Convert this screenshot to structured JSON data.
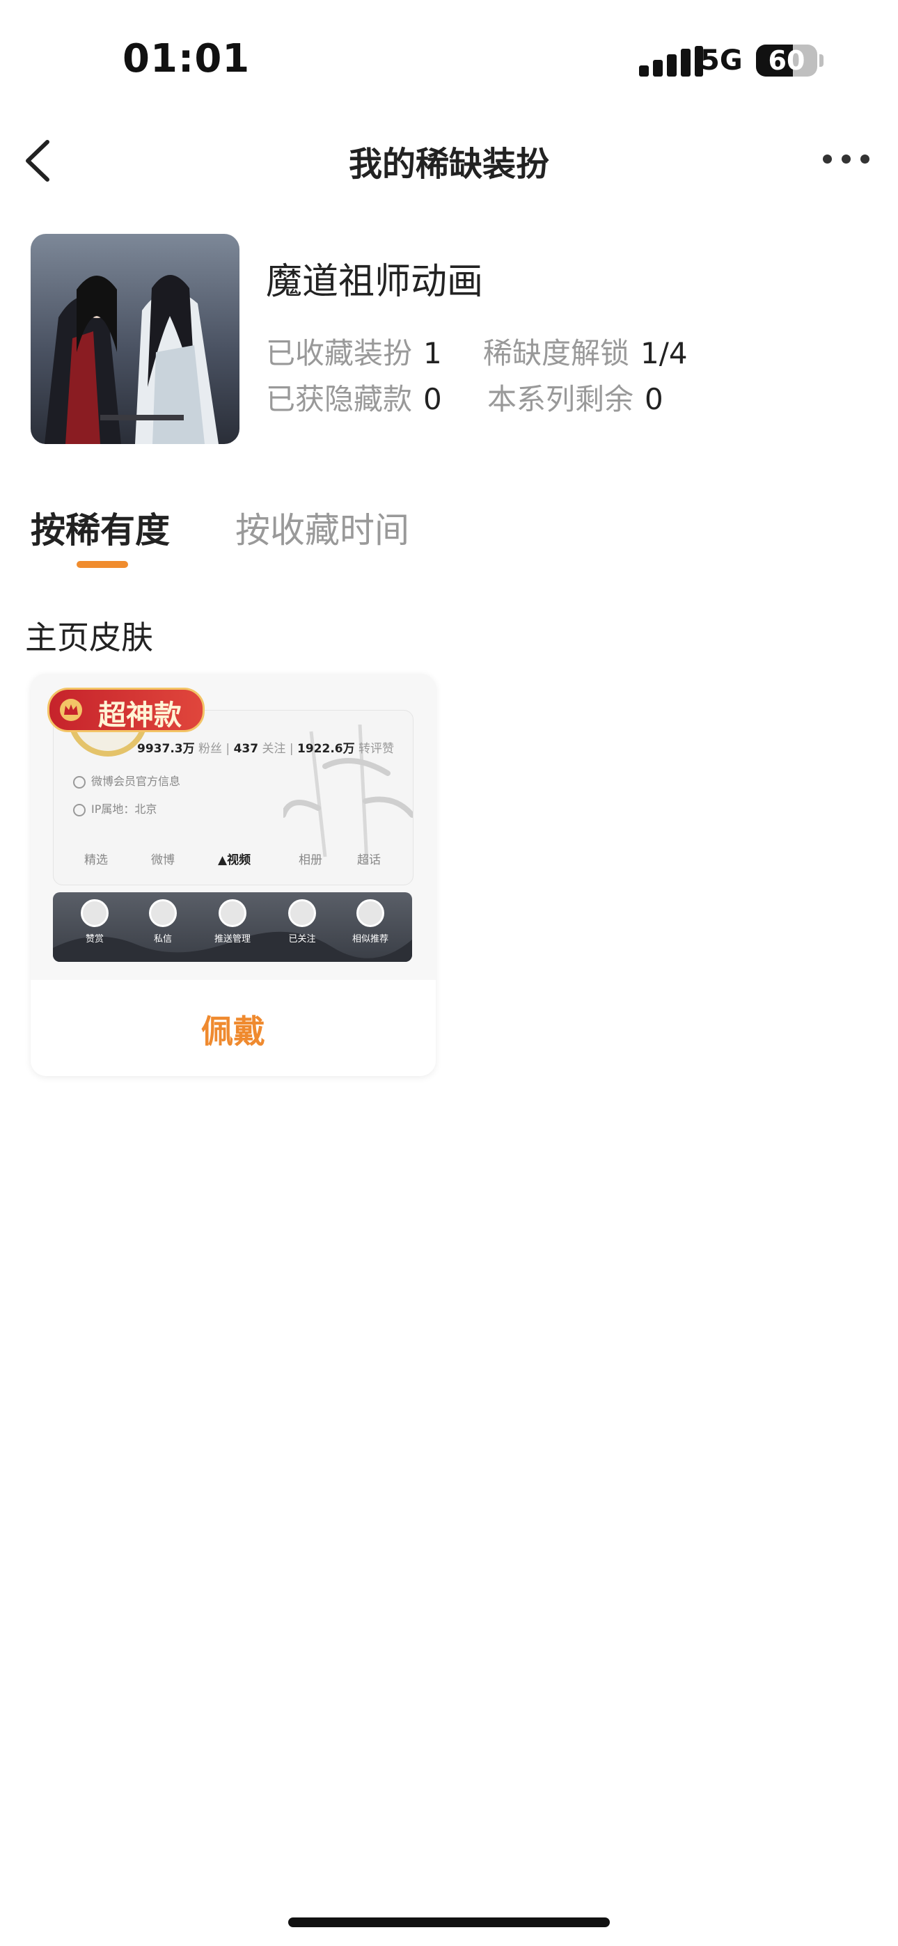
{
  "status_bar": {
    "time": "01:01",
    "network": "5G",
    "battery": "60"
  },
  "nav": {
    "title": "我的稀缺装扮"
  },
  "series": {
    "name": "魔道祖师动画",
    "stats": [
      {
        "label": "已收藏装扮",
        "value": "1"
      },
      {
        "label": "稀缺度解锁",
        "value": "1/4"
      },
      {
        "label": "已获隐藏款",
        "value": "0"
      },
      {
        "label": "本系列剩余",
        "value": "0"
      }
    ]
  },
  "tabs": [
    {
      "label": "按稀有度",
      "active": true
    },
    {
      "label": "按收藏时间",
      "active": false
    }
  ],
  "section_title": "主页皮肤",
  "skin_card": {
    "badge": "超神款",
    "wear_button": "佩戴",
    "preview": {
      "fans_value": "9937.3万",
      "fans_label": "粉丝",
      "following_value": "437",
      "following_label": "关注",
      "reposts_value": "1922.6万",
      "reposts_label": "转评赞",
      "verified_text": "微博会员官方信息",
      "ip_text": "IP属地：北京",
      "tabs": [
        "精选",
        "微博",
        "视频",
        "相册",
        "超话"
      ],
      "active_tab": "视频",
      "bottom_actions": [
        "赞赏",
        "私信",
        "推送管理",
        "已关注",
        "相似推荐"
      ]
    }
  },
  "colors": {
    "accent": "#f08c2e",
    "badge_red": "#d13a32",
    "text_muted": "#999999"
  }
}
